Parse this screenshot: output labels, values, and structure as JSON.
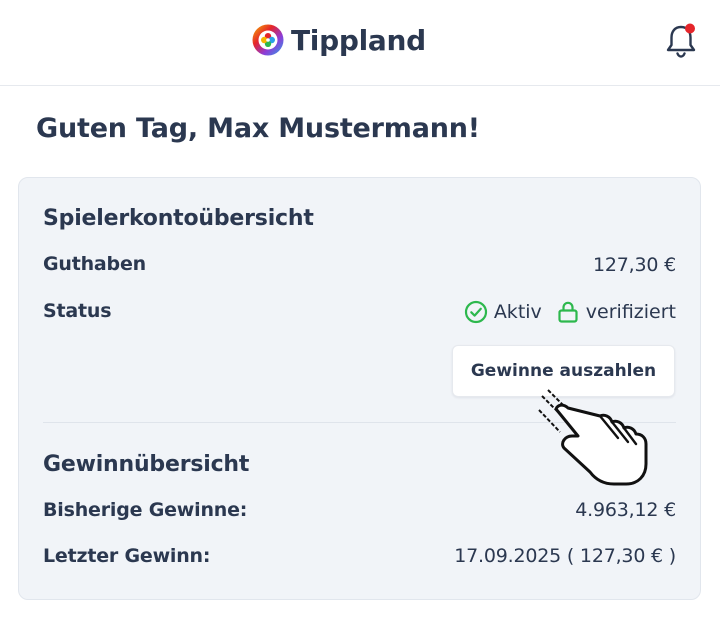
{
  "header": {
    "brand_name": "Tippland",
    "logo_icon": "tippland-logo-icon",
    "notification_icon": "bell-icon",
    "has_unread_notifications": true,
    "notification_dot_color": "#e5252a"
  },
  "greeting": "Guten Tag, Max Mustermann!",
  "account": {
    "title": "Spielerkontoübersicht",
    "balance_label": "Guthaben",
    "balance_value": "127,30 €",
    "status_label": "Status",
    "status_active": "Aktiv",
    "status_active_icon": "check-circle-icon",
    "status_verified": "verifiziert",
    "status_verified_icon": "lock-icon",
    "status_color": "#2db84d",
    "payout_button_label": "Gewinne auszahlen"
  },
  "winnings": {
    "title": "Gewinnübersicht",
    "total_label": "Bisherige Gewinne:",
    "total_value": "4.963,12 €",
    "last_label": "Letzter Gewinn:",
    "last_value": "17.09.2025 ( 127,30 € )"
  },
  "cursor_icon": "hand-pointer-icon"
}
